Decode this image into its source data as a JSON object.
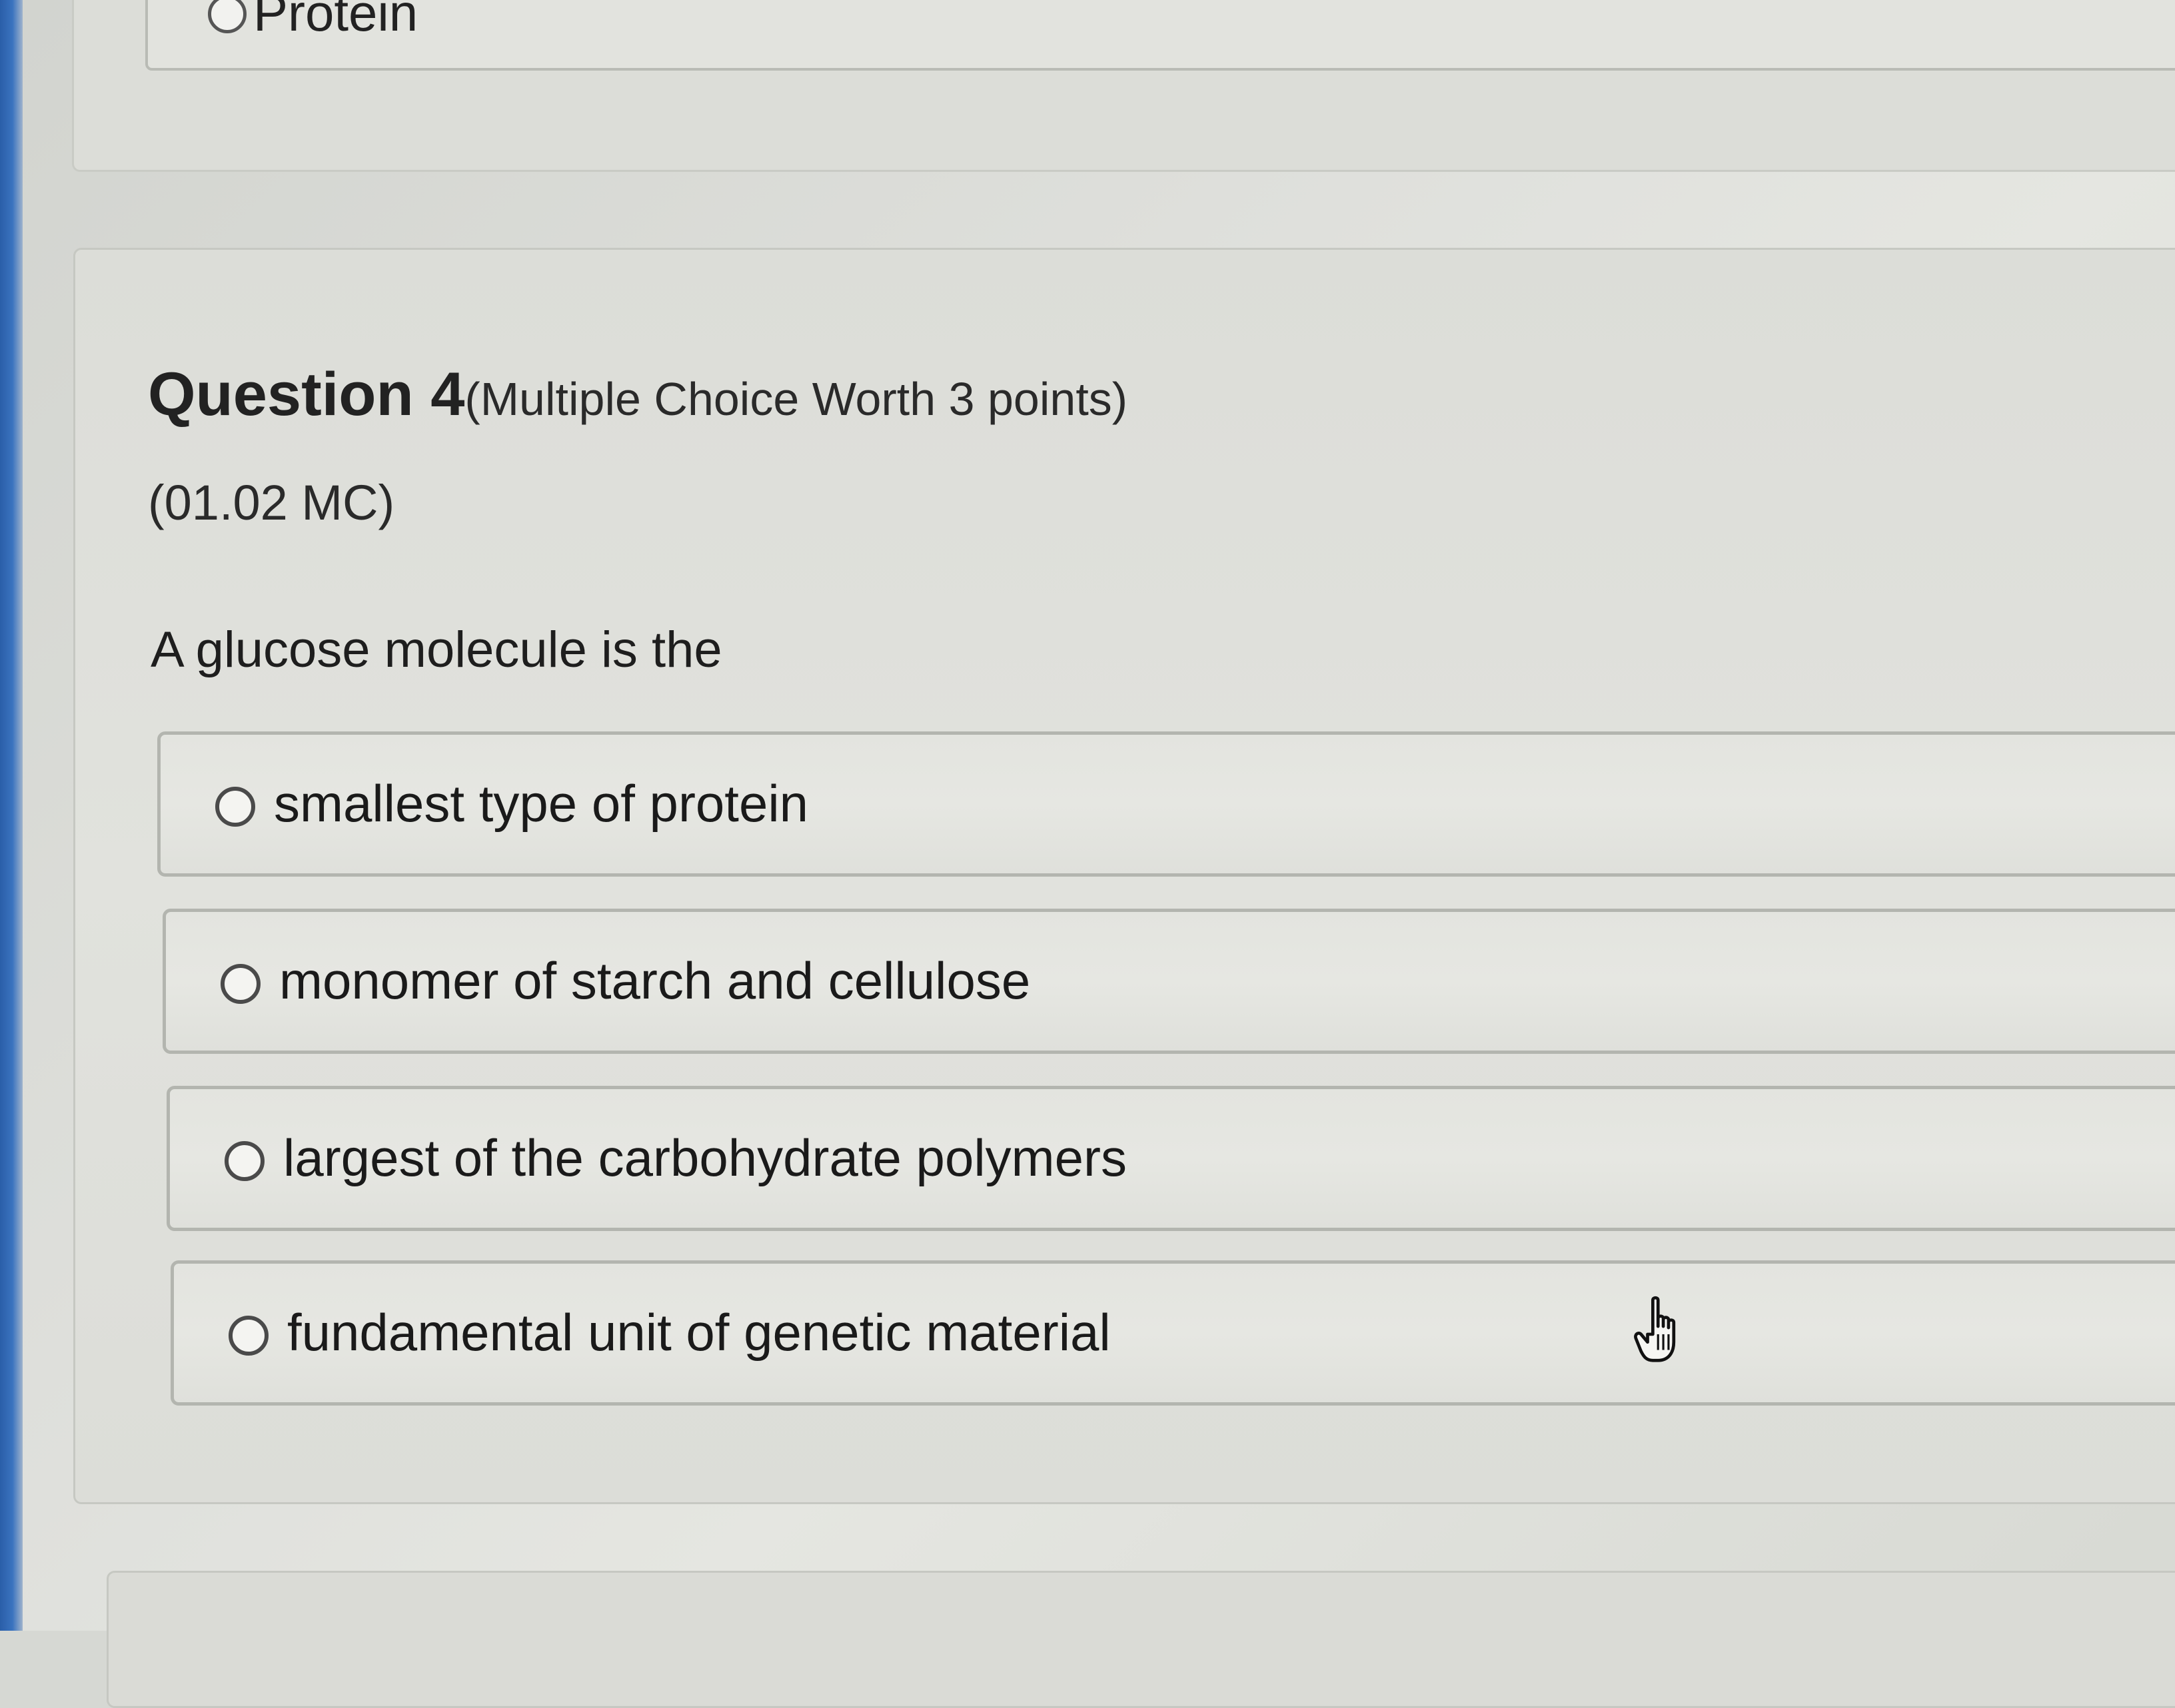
{
  "previous_question": {
    "visible_option_label": "Protein"
  },
  "question": {
    "number_label": "Question 4",
    "meta_label": "(Multiple Choice Worth 3 points)",
    "code": "(01.02 MC)",
    "stem": "A glucose molecule is the",
    "options": [
      {
        "label": "smallest type of protein",
        "selected": false
      },
      {
        "label": "monomer of starch and cellulose",
        "selected": false
      },
      {
        "label": "largest of the carbohydrate polymers",
        "selected": false
      },
      {
        "label": "fundamental unit of genetic material",
        "selected": false
      }
    ]
  },
  "cursor": {
    "icon": "hand-pointer-icon"
  },
  "colors": {
    "background": "#dfe0dc",
    "option_border": "#b3b5af",
    "text": "#1f1f1f",
    "bezel": "#3a73bf"
  }
}
